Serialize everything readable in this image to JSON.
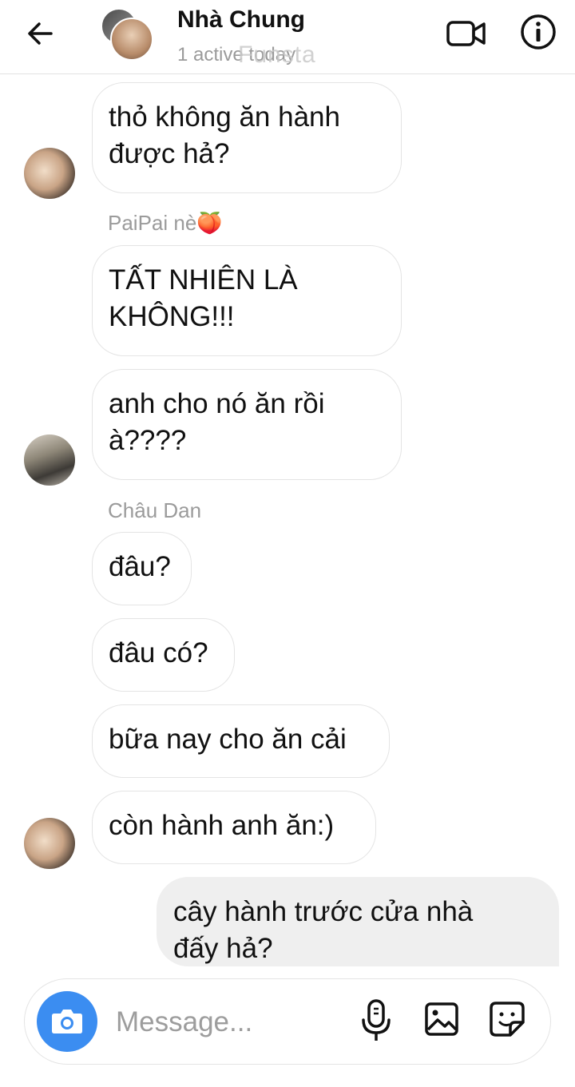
{
  "header": {
    "title": "Nhà Chung",
    "subtitle": "1 active today",
    "watermark": "Funsta"
  },
  "messages": [
    {
      "text": "thỏ không ăn hành\nđược hả?"
    },
    {
      "sender": "PaiPai nè🍑",
      "text": "TẤT NHIÊN LÀ\nKHÔNG!!!"
    },
    {
      "text": "anh cho nó ăn rồi\nà????"
    },
    {
      "sender": "Châu Dan",
      "text": "đâu?"
    },
    {
      "text": "đâu có?"
    },
    {
      "text": "bữa nay cho ăn cải"
    },
    {
      "text": "còn hành anh ăn:)"
    },
    {
      "text": "cây hành trước cửa nhà\nđấy hả?"
    }
  ],
  "composer": {
    "placeholder": "Message..."
  },
  "colors": {
    "accent": "#3b8df1",
    "bubble_border": "#e4e4e4",
    "my_bubble": "#efefef"
  },
  "icons": [
    "back-arrow-icon",
    "video-call-icon",
    "info-icon",
    "camera-icon",
    "microphone-icon",
    "gallery-icon",
    "sticker-icon"
  ]
}
